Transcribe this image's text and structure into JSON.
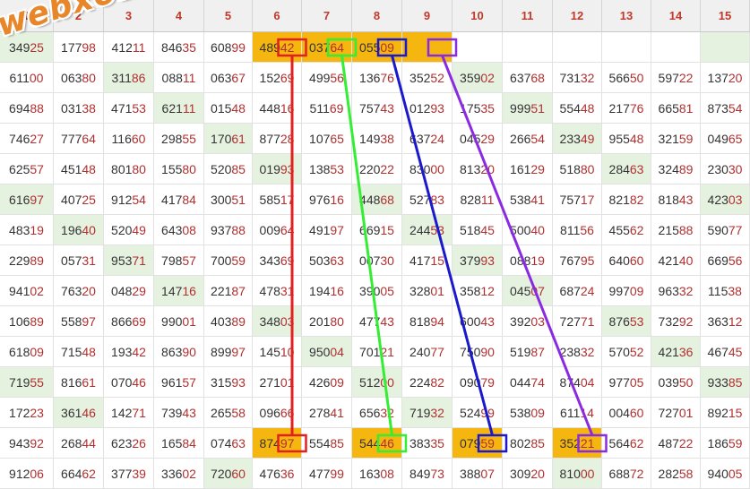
{
  "columns": [
    "1",
    "2",
    "3",
    "4",
    "5",
    "6",
    "7",
    "8",
    "9",
    "10",
    "11",
    "12",
    "13",
    "14",
    "15"
  ],
  "rows": [
    [
      "34925",
      "17798",
      "41211",
      "84635",
      "60899",
      "48942",
      "03764",
      "05509",
      "",
      "",
      "",
      "",
      "",
      "",
      ""
    ],
    [
      "61100",
      "06380",
      "31186",
      "08811",
      "06367",
      "15269",
      "49956",
      "13676",
      "35252",
      "35902",
      "63768",
      "73132",
      "56650",
      "59722",
      "13720"
    ],
    [
      "69488",
      "03138",
      "47153",
      "62111",
      "01548",
      "44816",
      "51169",
      "75743",
      "01293",
      "17535",
      "99951",
      "55448",
      "21776",
      "66581",
      "87354"
    ],
    [
      "74627",
      "77764",
      "11660",
      "29855",
      "17061",
      "87728",
      "10765",
      "14938",
      "63724",
      "04529",
      "26654",
      "23349",
      "95548",
      "32159",
      "04965"
    ],
    [
      "62557",
      "45148",
      "80180",
      "15580",
      "52085",
      "01993",
      "13853",
      "22022",
      "83000",
      "81320",
      "16129",
      "51880",
      "28463",
      "32489",
      "23030"
    ],
    [
      "61697",
      "40725",
      "91254",
      "41784",
      "30051",
      "58517",
      "97616",
      "44868",
      "52783",
      "82811",
      "53841",
      "75717",
      "82182",
      "81843",
      "42303"
    ],
    [
      "48319",
      "19640",
      "52049",
      "64308",
      "93788",
      "00964",
      "49197",
      "66915",
      "24453",
      "51845",
      "50040",
      "81156",
      "45562",
      "21588",
      "59077"
    ],
    [
      "22989",
      "05731",
      "95371",
      "79857",
      "70059",
      "34369",
      "50363",
      "00730",
      "41715",
      "37993",
      "08819",
      "76795",
      "64060",
      "42140",
      "66956"
    ],
    [
      "94102",
      "76320",
      "04829",
      "14716",
      "22187",
      "47831",
      "19416",
      "39005",
      "32801",
      "35812",
      "04507",
      "68724",
      "99709",
      "96332",
      "11538"
    ],
    [
      "10689",
      "55897",
      "86669",
      "99001",
      "40389",
      "34803",
      "20180",
      "47743",
      "81894",
      "60043",
      "39203",
      "72771",
      "87653",
      "73292",
      "36312"
    ],
    [
      "61809",
      "71548",
      "19342",
      "86390",
      "89997",
      "14510",
      "95004",
      "70121",
      "24077",
      "75090",
      "51987",
      "23832",
      "57052",
      "42136",
      "46745"
    ],
    [
      "71955",
      "81661",
      "07046",
      "96157",
      "31593",
      "27101",
      "42609",
      "51200",
      "22482",
      "09079",
      "04474",
      "87404",
      "97705",
      "03950",
      "93385"
    ],
    [
      "17223",
      "36146",
      "14271",
      "73943",
      "26558",
      "09666",
      "27841",
      "65632",
      "71932",
      "52499",
      "53809",
      "61114",
      "00460",
      "72701",
      "89215"
    ],
    [
      "94392",
      "26844",
      "62326",
      "16584",
      "07463",
      "87497",
      "55485",
      "54446",
      "38335",
      "07959",
      "80285",
      "35221",
      "56462",
      "48722",
      "18659"
    ],
    [
      "91206",
      "66462",
      "37739",
      "33602",
      "72060",
      "47636",
      "47799",
      "16308",
      "84973",
      "38807",
      "30920",
      "81000",
      "68872",
      "28258",
      "94005"
    ]
  ],
  "green_cells": [
    [
      0,
      0
    ],
    [
      0,
      14
    ],
    [
      1,
      2
    ],
    [
      1,
      9
    ],
    [
      2,
      3
    ],
    [
      2,
      10
    ],
    [
      3,
      4
    ],
    [
      3,
      11
    ],
    [
      4,
      5
    ],
    [
      4,
      12
    ],
    [
      5,
      0
    ],
    [
      5,
      7
    ],
    [
      5,
      14
    ],
    [
      6,
      1
    ],
    [
      6,
      8
    ],
    [
      7,
      2
    ],
    [
      7,
      9
    ],
    [
      8,
      3
    ],
    [
      8,
      10
    ],
    [
      9,
      5
    ],
    [
      9,
      12
    ],
    [
      10,
      6
    ],
    [
      10,
      13
    ],
    [
      11,
      0
    ],
    [
      11,
      7
    ],
    [
      11,
      14
    ],
    [
      12,
      1
    ],
    [
      12,
      8
    ],
    [
      14,
      4
    ],
    [
      14,
      11
    ]
  ],
  "orange_cells": [
    [
      0,
      5
    ],
    [
      0,
      6
    ],
    [
      0,
      7
    ],
    [
      0,
      8
    ],
    [
      13,
      5
    ],
    [
      13,
      7
    ],
    [
      13,
      9
    ],
    [
      13,
      11
    ]
  ],
  "colors": {
    "red": "#e32020",
    "green": "#33ee33",
    "blue": "#1a1acc",
    "purple": "#8a2be2",
    "orange": "#f5b60f",
    "green_cell": "#e6f2e0"
  },
  "highlights": [
    {
      "color": "red",
      "from": [
        0,
        5
      ],
      "to": [
        13,
        5
      ]
    },
    {
      "color": "green",
      "from": [
        0,
        6
      ],
      "to": [
        13,
        7
      ]
    },
    {
      "color": "blue",
      "from": [
        0,
        7
      ],
      "to": [
        13,
        9
      ]
    },
    {
      "color": "purple",
      "from": [
        0,
        8
      ],
      "to": [
        13,
        11
      ]
    }
  ],
  "watermark": "webxoso.net"
}
